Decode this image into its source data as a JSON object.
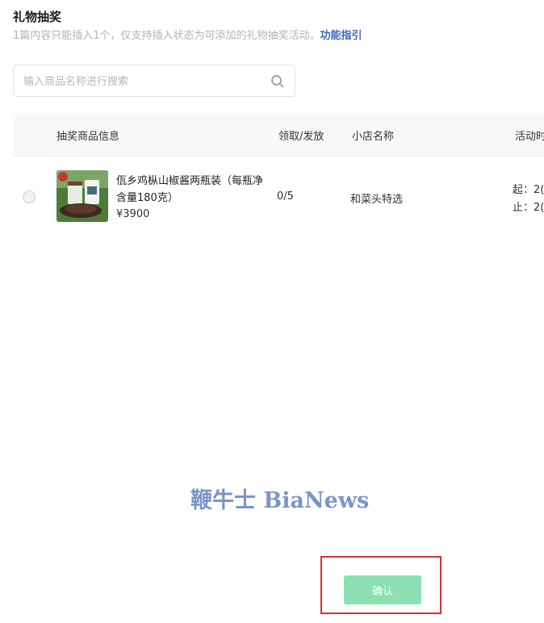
{
  "header": {
    "title": "礼物抽奖",
    "description": "1篇内容只能插入1个，仅支持插入状态为可添加的礼物抽奖活动。",
    "guide_link": "功能指引"
  },
  "search": {
    "placeholder": "输入商品名称进行搜索",
    "value": ""
  },
  "table": {
    "columns": [
      "抽奖商品信息",
      "领取/发放",
      "小店名称",
      "活动时"
    ],
    "rows": [
      {
        "product_name": "佤乡鸡枞山椒酱两瓶装（每瓶净含量180克）",
        "price": "¥3900",
        "claimed_issued": "0/5",
        "shop_name": "和菜头特选",
        "time_start": "起：2(",
        "time_end": "止：2("
      }
    ]
  },
  "watermark": "鞭牛士 BiaNews",
  "footer": {
    "confirm_label": "确认"
  },
  "colors": {
    "confirm_bg": "#8ce0b2",
    "highlight_border": "#d9302c",
    "link": "#3d6ab3"
  }
}
